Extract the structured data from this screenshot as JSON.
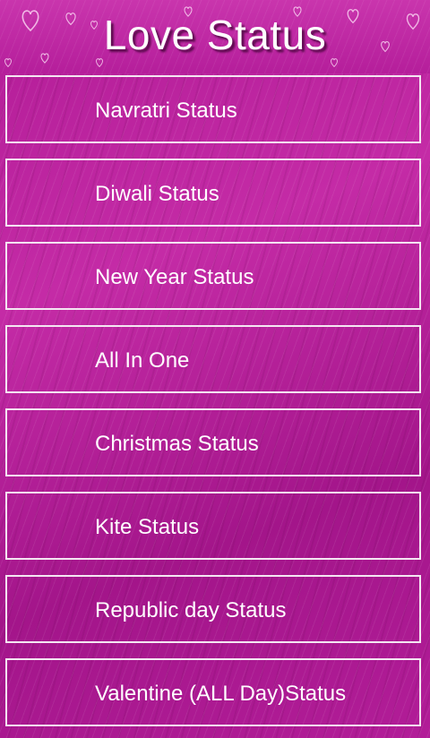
{
  "header": {
    "title": "Love Status"
  },
  "menu": {
    "items": [
      {
        "label": "Navratri Status"
      },
      {
        "label": "Diwali Status"
      },
      {
        "label": "New Year Status"
      },
      {
        "label": "All In One"
      },
      {
        "label": "Christmas Status"
      },
      {
        "label": "Kite Status"
      },
      {
        "label": "Republic day Status"
      },
      {
        "label": "Valentine (ALL Day)Status"
      }
    ]
  },
  "colors": {
    "background": "#b21c97",
    "border": "#f4e6f2",
    "text": "#ffffff"
  },
  "icons": {
    "decoration": "heart-outline-icon"
  }
}
